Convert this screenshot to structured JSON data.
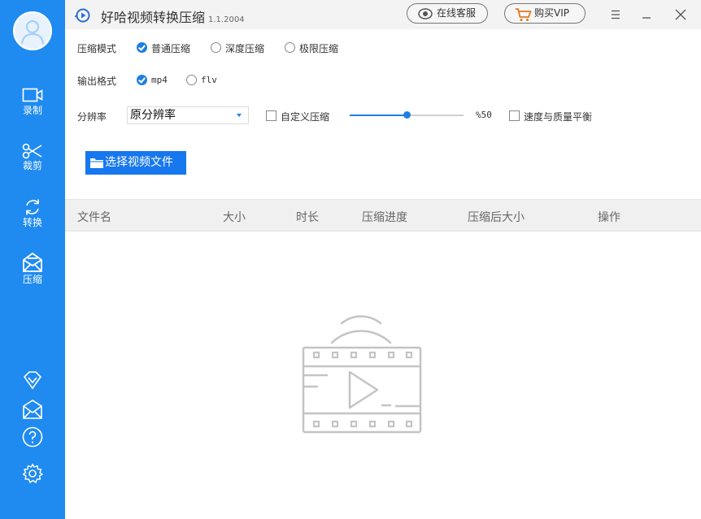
{
  "app": {
    "title": "好哈视频转换压缩",
    "version": "1.1.2004"
  },
  "titlebar": {
    "support_label": "在线客服",
    "buy_label": "购买VIP"
  },
  "sidebar": {
    "items": [
      {
        "label": "录制",
        "icon": "video-camera-icon"
      },
      {
        "label": "裁剪",
        "icon": "scissors-icon"
      },
      {
        "label": "转换",
        "icon": "refresh-icon"
      },
      {
        "label": "压缩",
        "icon": "compress-envelope-icon"
      }
    ],
    "bottom_icons": [
      "diamond-icon",
      "envelope-icon",
      "help-icon",
      "settings-icon"
    ]
  },
  "options": {
    "compress_mode": {
      "label": "压缩模式",
      "choices": [
        "普通压缩",
        "深度压缩",
        "极限压缩"
      ],
      "selected": "普通压缩"
    },
    "output_format": {
      "label": "输出格式",
      "choices": [
        "mp4",
        "flv"
      ],
      "selected": "mp4"
    },
    "resolution": {
      "label": "分辨率",
      "value": "原分辨率"
    },
    "custom_compress": {
      "label": "自定义压缩",
      "checked": false
    },
    "quality_slider": {
      "value_label": "%50",
      "fraction": 0.5
    },
    "balance": {
      "label": "速度与质量平衡",
      "checked": false
    }
  },
  "select_file_label": "选择视频文件",
  "table": {
    "columns": [
      "文件名",
      "大小",
      "时长",
      "压缩进度",
      "压缩后大小",
      "操作"
    ],
    "rows": []
  },
  "colors": {
    "sidebar": "#1f8bf0",
    "accent": "#1677ee",
    "header_bg": "#f0f0f0"
  }
}
